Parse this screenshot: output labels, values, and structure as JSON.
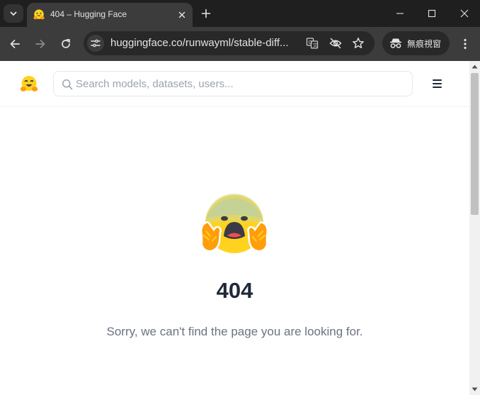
{
  "browser": {
    "tab": {
      "title": "404 – Hugging Face",
      "favicon": "hugging-face-emoji-icon"
    },
    "url": "huggingface.co/runwayml/stable-diff...",
    "profile_label": "無痕視窗",
    "icons": {
      "tab_search": "chevron-down-icon",
      "tab_close": "close-icon",
      "new_tab": "plus-icon",
      "back": "arrow-left-icon",
      "forward": "arrow-right-icon",
      "reload": "reload-icon",
      "site_info": "tune-icon",
      "translate": "translate-icon",
      "tracking": "eye-off-icon",
      "bookmark": "star-icon",
      "incognito": "incognito-icon",
      "menu": "kebab-menu-icon",
      "minimize": "minimize-icon",
      "maximize": "maximize-icon",
      "close_window": "close-icon"
    },
    "colors": {
      "titlebar": "#1f1f1f",
      "toolbar": "#3c3c3c",
      "omnibox": "#282828"
    }
  },
  "site": {
    "search": {
      "placeholder": "Search models, datasets, users..."
    },
    "error": {
      "code": "404",
      "message": "Sorry, we can't find the page you are looking for."
    },
    "icons": {
      "logo": "hugging-face-logo-icon",
      "search": "search-icon",
      "menu": "hamburger-menu-icon",
      "error_emoji": "hugging-face-screaming-emoji"
    },
    "colors": {
      "heading": "#1f2937",
      "muted": "#6b7280",
      "emoji_yellow": "#ffd21e",
      "emoji_orange": "#ff9d0b"
    }
  }
}
